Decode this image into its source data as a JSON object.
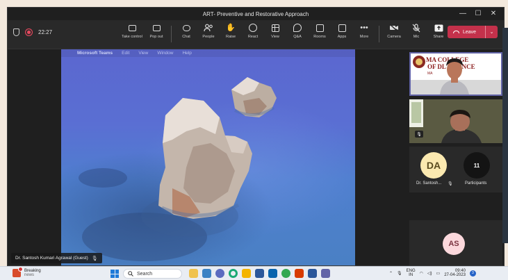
{
  "window": {
    "title": "ART- Preventive and Restorative Approach",
    "controls": {
      "minimize": "—",
      "maximize": "☐",
      "close": "✕"
    }
  },
  "toolbar": {
    "timer": "22:27",
    "tools": [
      {
        "label": "Take control",
        "icon": "take-control-icon"
      },
      {
        "label": "Pop out",
        "icon": "pop-out-icon"
      },
      {
        "label": "Chat",
        "icon": "chat-icon"
      },
      {
        "label": "People",
        "icon": "people-icon"
      },
      {
        "label": "Raise",
        "icon": "raise-hand-icon"
      },
      {
        "label": "React",
        "icon": "react-icon"
      },
      {
        "label": "View",
        "icon": "view-icon"
      },
      {
        "label": "Q&A",
        "icon": "qa-icon"
      },
      {
        "label": "Rooms",
        "icon": "rooms-icon"
      },
      {
        "label": "Apps",
        "icon": "apps-icon"
      },
      {
        "label": "More",
        "icon": "more-icon"
      },
      {
        "label": "Camera",
        "icon": "camera-off-icon"
      },
      {
        "label": "Mic",
        "icon": "mic-off-icon"
      },
      {
        "label": "Share",
        "icon": "share-icon"
      }
    ],
    "leave_label": "Leave",
    "leave_color": "#c4314b"
  },
  "shared_screen": {
    "menu": {
      "app": "Microsoft Teams",
      "items": [
        "Edit",
        "View",
        "Window",
        "Help"
      ]
    },
    "presenter_name": "Dr. Santosh Kumari Agrawal (Guest)"
  },
  "participants": {
    "vid1_banner_line1": "MA COLLEGE",
    "vid1_banner_line2": "OF DL SCIENCE",
    "vid1_banner_small": "MA",
    "tile_da": {
      "initials": "DA",
      "name": "Dr. Santosh...",
      "color": "#fbe9b0"
    },
    "tile_count": {
      "value": "11",
      "label": "Participants"
    },
    "tile_as": {
      "initials": "AS",
      "color": "#fbd8dc"
    }
  },
  "taskbar": {
    "weather_title": "Breaking",
    "weather_sub": "news",
    "weather_badge": "1",
    "search_placeholder": "Search",
    "lang_top": "ENG",
    "lang_bottom": "IN",
    "time": "09:40",
    "date": "27-04-2023",
    "notifications": "3"
  },
  "accent": "#6264a7"
}
